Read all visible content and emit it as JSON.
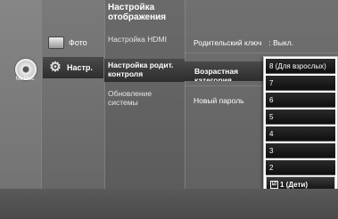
{
  "left_panel": {
    "disc_label": "No Disc"
  },
  "main_menu": {
    "photo": "Фото",
    "setup": "Настр."
  },
  "sub_menu": {
    "display": "Настройка отображения",
    "hdmi": "Настройка HDMI",
    "parental": "Настройка родит. контроля",
    "update": "Обновление системы"
  },
  "options": {
    "parental_key_label": "Родительский ключ",
    "parental_key_value": ": Выкл.",
    "age_category_label": "Возрастная категория",
    "new_password_label": "Новый пароль"
  },
  "dropdown": {
    "items": [
      "8 (Для взрослых)",
      "7",
      "6",
      "5",
      "4",
      "3",
      "2",
      "1 (Дети)"
    ],
    "selected_index": 7,
    "checkmark": "☑"
  }
}
